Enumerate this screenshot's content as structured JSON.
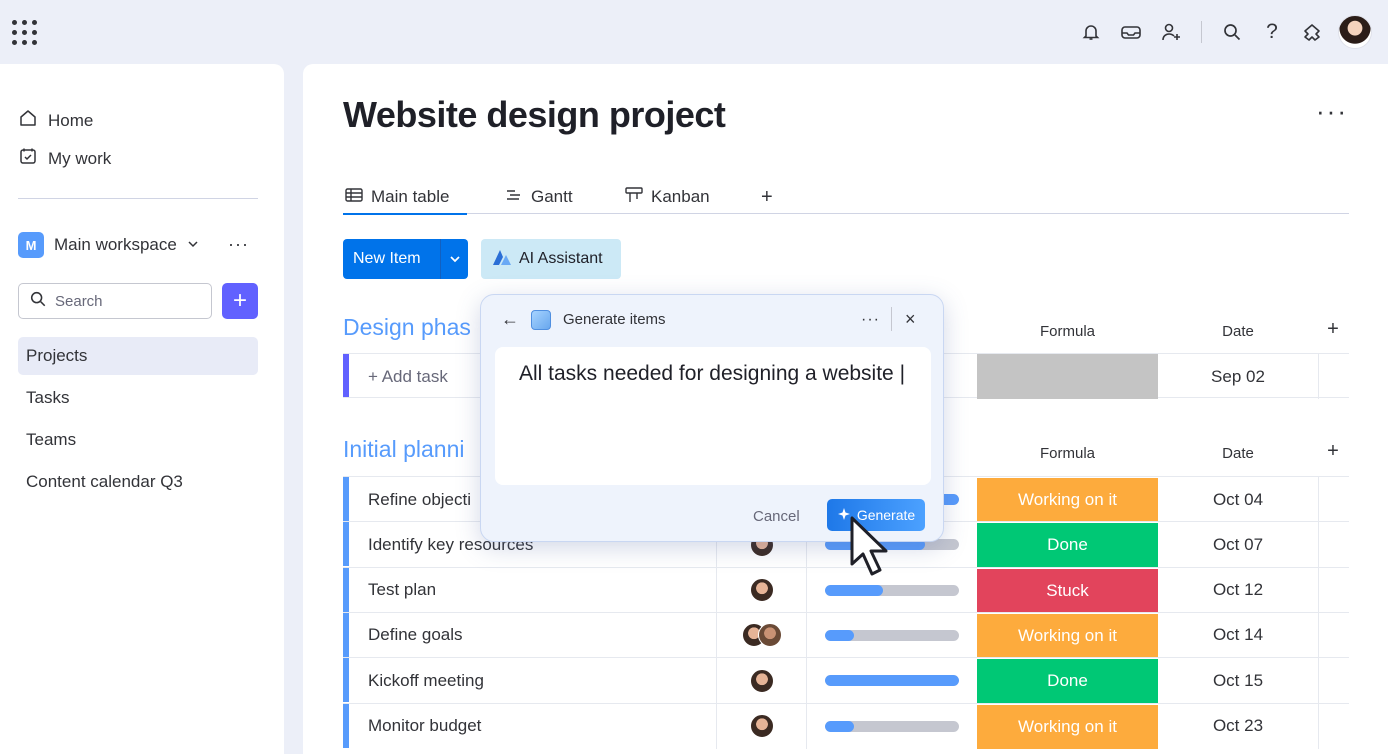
{
  "topbar": {
    "icons": [
      "bell-icon",
      "inbox-icon",
      "invite-member-icon",
      "search-icon",
      "help-icon",
      "apps-icon"
    ],
    "help_glyph": "?"
  },
  "sidebar": {
    "home": "Home",
    "my_work": "My work",
    "workspace_badge": "M",
    "workspace_name": "Main workspace",
    "workspace_more": "···",
    "search_placeholder": "Search",
    "add_label": "+",
    "items": [
      {
        "label": "Projects",
        "active": true
      },
      {
        "label": "Tasks",
        "active": false
      },
      {
        "label": "Teams",
        "active": false
      },
      {
        "label": "Content calendar Q3",
        "active": false
      }
    ]
  },
  "main": {
    "title": "Website design project",
    "more": "···",
    "tabs": [
      {
        "label": "Main table",
        "icon": "table-icon",
        "active": true
      },
      {
        "label": "Gantt",
        "icon": "gantt-icon",
        "active": false
      },
      {
        "label": "Kanban",
        "icon": "kanban-icon",
        "active": false
      }
    ],
    "add_tab": "+",
    "new_item": "New Item",
    "ai_assistant": "AI Assistant",
    "groups": [
      {
        "title": "Design phas",
        "columns": {
          "formula": "Formula",
          "date": "Date",
          "add": "+"
        },
        "rows": [
          {
            "task": "+ Add task",
            "status": "",
            "date": "Sep 02"
          }
        ]
      },
      {
        "title": "Initial planni",
        "columns": {
          "formula": "Formula",
          "date": "Date",
          "add": "+"
        },
        "rows": [
          {
            "task": "Refine objecti",
            "progress": 1.0,
            "status": "Working on it",
            "date": "Oct 04"
          },
          {
            "task": "Identify key resources",
            "progress": 0.75,
            "status": "Done",
            "date": "Oct 07"
          },
          {
            "task": "Test plan",
            "progress": 0.44,
            "status": "Stuck",
            "date": "Oct 12"
          },
          {
            "task": "Define goals",
            "progress": 0.22,
            "status": "Working on it",
            "date": "Oct 14"
          },
          {
            "task": "Kickoff meeting",
            "progress": 1.0,
            "status": "Done",
            "date": "Oct 15"
          },
          {
            "task": "Monitor budget",
            "progress": 0.22,
            "status": "Working on it",
            "date": "Oct 23"
          }
        ]
      }
    ]
  },
  "status_colors": {
    "Working on it": "#fdab3d",
    "Done": "#00c875",
    "Stuck": "#e2445c",
    "": "#c4c4c4"
  },
  "dialog": {
    "title": "Generate items",
    "more": "···",
    "close": "×",
    "back": "←",
    "text": "All tasks needed for designing a website |",
    "cancel": "Cancel",
    "generate": "Generate"
  }
}
